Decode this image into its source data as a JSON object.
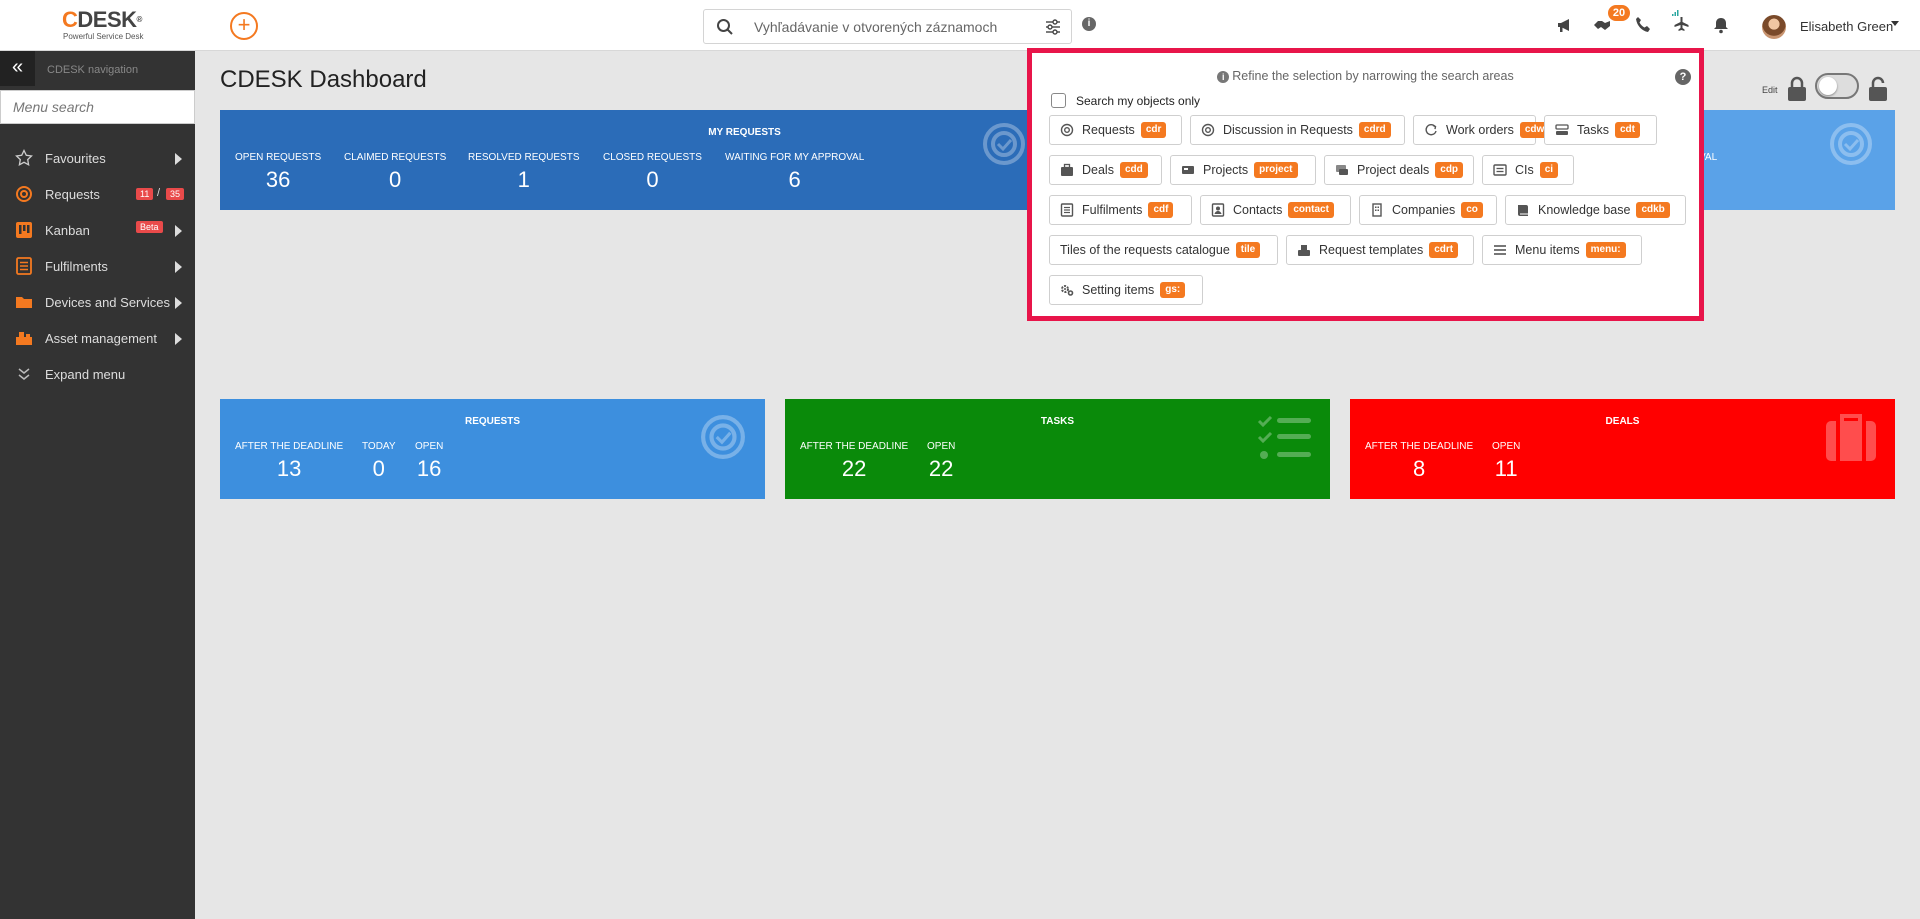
{
  "header": {
    "logo_text": "DESK",
    "logo_c": "C",
    "logo_reg": "®",
    "logo_tagline": "Powerful Service Desk",
    "add_glyph": "+",
    "search_placeholder": "Vyhľadávanie v otvorených záznamoch",
    "info_glyph": "i",
    "notification_count": "20",
    "user_name": "Elisabeth Green"
  },
  "sidebar": {
    "collapse_glyph": "«",
    "title": "CDESK navigation",
    "menu_search_placeholder": "Menu search",
    "items": [
      {
        "label": "Favourites",
        "icon": "star-icon"
      },
      {
        "label": "Requests",
        "icon": "requests-icon",
        "badge_open": "11",
        "slash": "/",
        "badge_total": "35"
      },
      {
        "label": "Kanban",
        "icon": "kanban-icon",
        "badge": "Beta"
      },
      {
        "label": "Fulfilments",
        "icon": "fulfilments-icon"
      },
      {
        "label": "Devices and Services",
        "icon": "folder-icon"
      },
      {
        "label": "Asset management",
        "icon": "asset-icon"
      },
      {
        "label": "Expand menu",
        "icon": "expand-icon"
      }
    ]
  },
  "main": {
    "title": "CDESK Dashboard",
    "edit_label": "Edit"
  },
  "cards": {
    "my_requests": {
      "title": "MY REQUESTS",
      "stats": [
        {
          "label": "OPEN REQUESTS",
          "value": "36"
        },
        {
          "label": "CLAIMED REQUESTS",
          "value": "0"
        },
        {
          "label": "RESOLVED REQUESTS",
          "value": "1"
        },
        {
          "label": "CLOSED REQUESTS",
          "value": "0"
        },
        {
          "label": "WAITING FOR MY APPROVAL",
          "value": "6"
        }
      ]
    },
    "second_partial_label": "VAL",
    "requests": {
      "title": "REQUESTS",
      "stats": [
        {
          "label": "AFTER THE DEADLINE",
          "value": "13"
        },
        {
          "label": "TODAY",
          "value": "0"
        },
        {
          "label": "OPEN",
          "value": "16"
        }
      ]
    },
    "tasks": {
      "title": "TASKS",
      "stats": [
        {
          "label": "AFTER THE DEADLINE",
          "value": "22"
        },
        {
          "label": "OPEN",
          "value": "22"
        }
      ]
    },
    "deals": {
      "title": "DEALS",
      "stats": [
        {
          "label": "AFTER THE DEADLINE",
          "value": "8"
        },
        {
          "label": "OPEN",
          "value": "11"
        }
      ]
    }
  },
  "colors": {
    "accent": "#f47920",
    "sidebar": "#333333",
    "my_requests": "#2b6cb8",
    "my_approvals": "#5aa2e8",
    "requests": "#3d8fde",
    "tasks": "#0a8a0a",
    "deals": "#ff0000",
    "panel_border": "#e8154a"
  },
  "panel": {
    "hint": "Refine the selection by narrowing the search areas",
    "help_glyph": "?",
    "own_only_label": "Search my objects only",
    "chips": [
      {
        "label": "Requests",
        "tag": "cdr",
        "icon": "requests-icon"
      },
      {
        "label": "Discussion in Requests",
        "tag": "cdrd",
        "icon": "discussion-icon"
      },
      {
        "label": "Work orders",
        "tag": "cdw",
        "icon": "work-order-icon"
      },
      {
        "label": "Tasks",
        "tag": "cdt",
        "icon": "tasks-icon"
      },
      {
        "label": "Deals",
        "tag": "cdd",
        "icon": "briefcase-icon"
      },
      {
        "label": "Projects",
        "tag": "project",
        "icon": "projects-icon"
      },
      {
        "label": "Project deals",
        "tag": "cdp",
        "icon": "project-deals-icon"
      },
      {
        "label": "CIs",
        "tag": "ci",
        "icon": "ci-icon"
      },
      {
        "label": "Fulfilments",
        "tag": "cdf",
        "icon": "fulfilments-icon"
      },
      {
        "label": "Contacts",
        "tag": "contact",
        "icon": "contact-icon"
      },
      {
        "label": "Companies",
        "tag": "co",
        "icon": "company-icon"
      },
      {
        "label": "Knowledge base",
        "tag": "cdkb",
        "icon": "book-icon"
      },
      {
        "label": "Tiles of the requests catalogue",
        "tag": "tile",
        "icon": "none"
      },
      {
        "label": "Request templates",
        "tag": "cdrt",
        "icon": "template-icon"
      },
      {
        "label": "Menu items",
        "tag": "menu:",
        "icon": "menu-icon"
      },
      {
        "label": "Setting items",
        "tag": "gs:",
        "icon": "gears-icon"
      }
    ]
  }
}
